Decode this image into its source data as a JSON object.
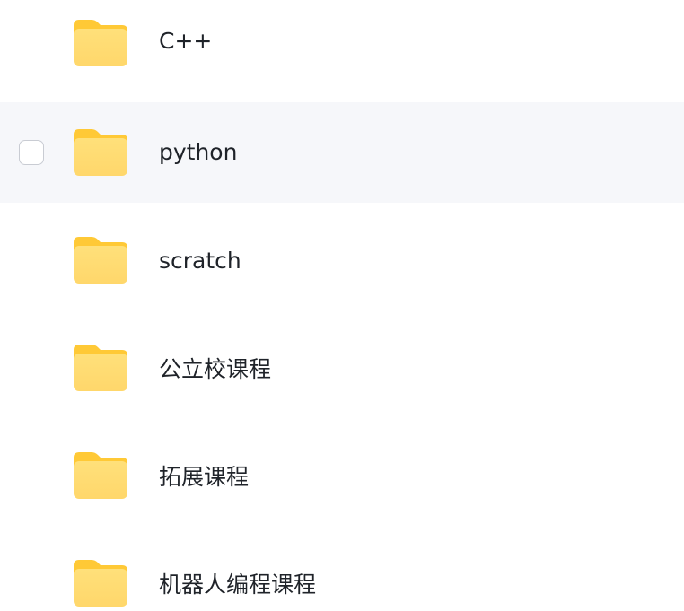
{
  "file_list": {
    "items": [
      {
        "name": "C++",
        "icon": "folder-icon",
        "type": "folder"
      },
      {
        "name": "python",
        "icon": "folder-icon",
        "type": "folder",
        "hovered": true,
        "checked": false
      },
      {
        "name": "scratch",
        "icon": "folder-icon",
        "type": "folder"
      },
      {
        "name": "公立校课程",
        "icon": "folder-icon",
        "type": "folder"
      },
      {
        "name": "拓展课程",
        "icon": "folder-icon",
        "type": "folder"
      },
      {
        "name": "机器人编程课程",
        "icon": "folder-icon",
        "type": "folder"
      }
    ]
  },
  "colors": {
    "folder_tab": "#ffc936",
    "folder_body_top": "#ffe07a",
    "folder_body_bottom": "#ffd76b",
    "hover_background": "#f6f7fa",
    "text": "#1f2329",
    "checkbox_border": "#c9ccd3"
  }
}
